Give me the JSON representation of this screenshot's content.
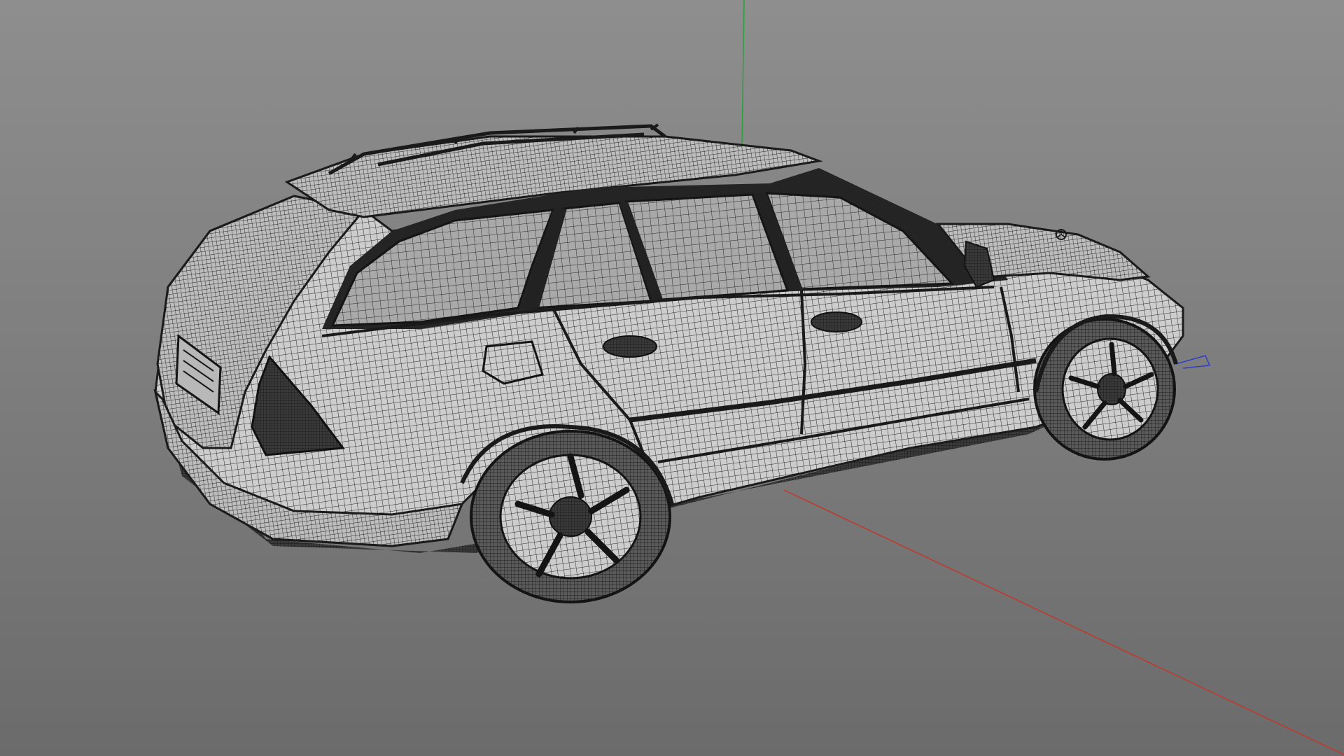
{
  "viewport": {
    "view": "perspective",
    "display_mode": "wireframe",
    "background": {
      "top": "#8e8e8e",
      "bottom": "#6b6b6b"
    }
  },
  "axes": {
    "x_color": "#c0392b",
    "y_color": "#2e9e3e",
    "z_color": "#2e3fbf"
  },
  "model": {
    "description_icon": "station-wagon-wireframe",
    "wire_color": "#1e1e1e",
    "surface_color": "#cfcfcf",
    "glass_color": "#9a9a9a"
  }
}
